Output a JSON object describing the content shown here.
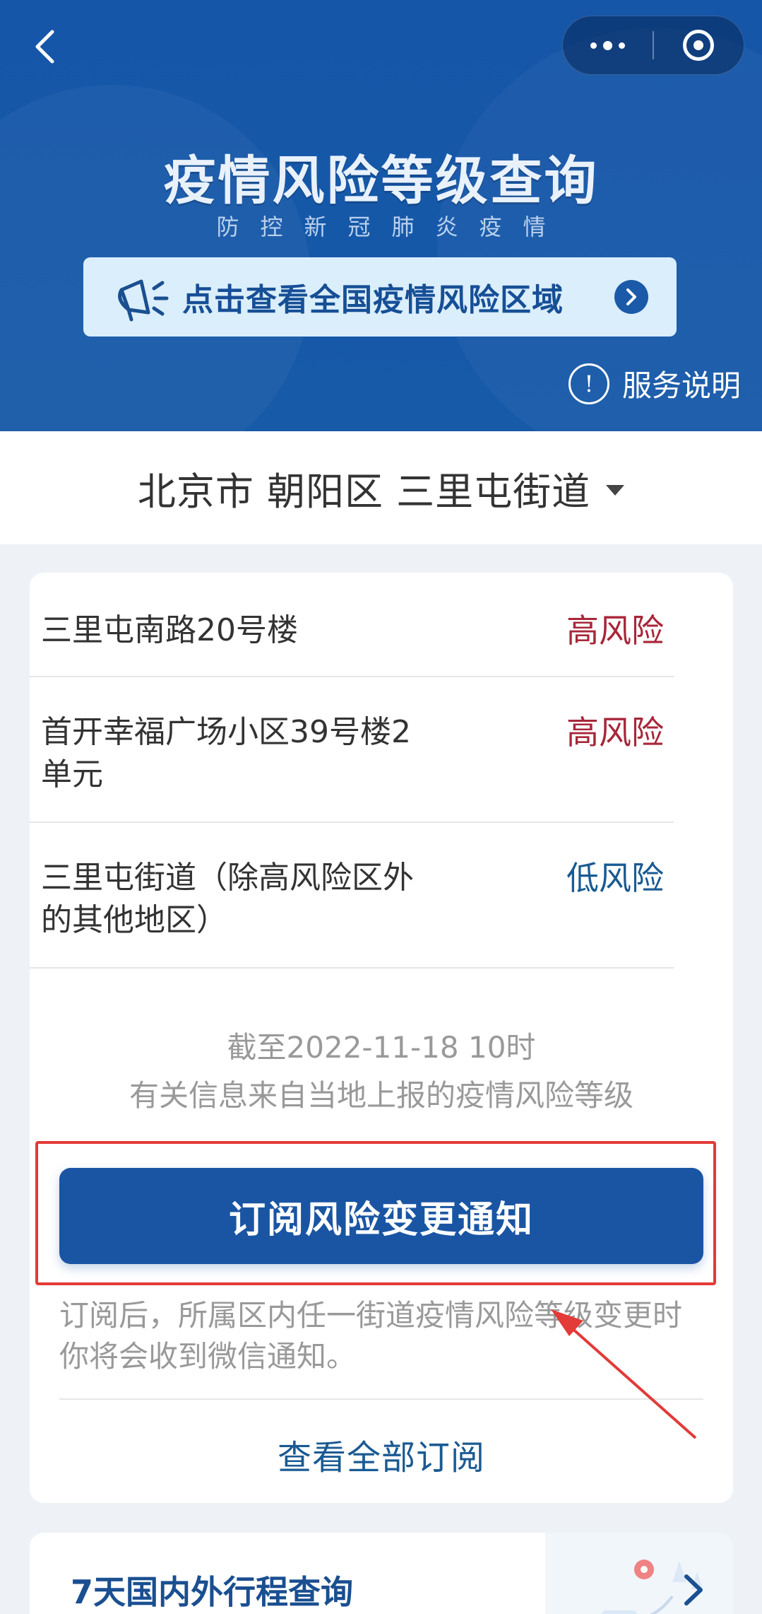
{
  "header": {
    "title": "疫情风险等级查询",
    "subtitle": "防控新冠肺炎疫情",
    "banner_text": "点击查看全国疫情风险区域",
    "service_label": "服务说明",
    "service_icon_glyph": "!"
  },
  "location": {
    "text": "北京市 朝阳区 三里屯街道"
  },
  "areas": [
    {
      "name": "三里屯南路20号楼",
      "risk": "高风险"
    },
    {
      "name": "首开幸福广场小区39号楼2单元",
      "risk": "高风险"
    },
    {
      "name": "三里屯街道（除高风险区外的其他地区）",
      "risk": "低风险"
    }
  ],
  "meta": {
    "as_of": "截至2022-11-18 10时",
    "source": "有关信息来自当地上报的疫情风险等级"
  },
  "subscribe": {
    "button_label": "订阅风险变更通知",
    "note": "订阅后，所属区内任一街道疫情风险等级变更时你将会收到微信通知。",
    "view_all_label": "查看全部订阅"
  },
  "bottom_card": {
    "label": "7天国内外行程查询"
  },
  "colors": {
    "brand": "#1556a8",
    "high_risk": "#a8273a",
    "low_risk": "#1a5a92",
    "annotation": "#e23b38"
  }
}
